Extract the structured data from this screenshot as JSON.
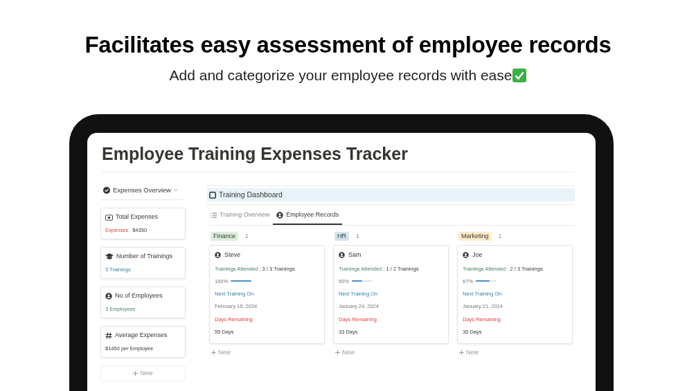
{
  "headline": "Facilitates easy assessment of employee records",
  "subheadline": "Add and categorize your employee records with ease",
  "page": {
    "title": "Employee Training Expenses Tracker"
  },
  "sidebar": {
    "heading": "Expenses Overview",
    "new_label": "New",
    "cards": [
      {
        "kind": "money",
        "title": "Total Expenses",
        "label": "Expenses : ",
        "value": "$4350"
      },
      {
        "kind": "cap",
        "title": "Number of Trainings",
        "label": "3 Trainings"
      },
      {
        "kind": "person",
        "title": "No of Employees",
        "label": "3 Employees"
      },
      {
        "kind": "hash",
        "title": "Average Expenses",
        "label": "$1450 per Employee"
      }
    ]
  },
  "dashboard": {
    "title": "Training Dashboard",
    "tabs": [
      {
        "kind": "list",
        "label": "Training Overview",
        "selected": false
      },
      {
        "kind": "person",
        "label": "Employee Records",
        "selected": true
      }
    ],
    "groups": [
      {
        "name": "Finance",
        "count": "1",
        "color": "#dbeddb",
        "new_label": "New",
        "card": {
          "name": "Steve",
          "attended_label": "Trainings Attended : ",
          "attended": "3 / 3 Trainings",
          "percent": "100%",
          "level": 1,
          "next_label": "Next Training On",
          "next_date": "February 15, 2024",
          "remaining_label": "Days Remaining",
          "remaining": "55 Days"
        }
      },
      {
        "name": "HR",
        "count": "1",
        "color": "#d3e5ef",
        "new_label": "New",
        "card": {
          "name": "Sam",
          "attended_label": "Trainings Attended : ",
          "attended": "1 / 2 Trainings",
          "percent": "50%",
          "level": 0.5,
          "next_label": "Next Training On",
          "next_date": "January 24, 2024",
          "remaining_label": "Days Remaining",
          "remaining": "33 Days"
        }
      },
      {
        "name": "Marketing",
        "count": "1",
        "color": "#fdecc8",
        "new_label": "New",
        "card": {
          "name": "Joe",
          "attended_label": "Trainings Attended : ",
          "attended": "2 / 3 Trainings",
          "percent": "67%",
          "level": 0.67,
          "next_label": "Next Training On",
          "next_date": "January 21, 2024",
          "remaining_label": "Days Remaining",
          "remaining": "30 Days"
        }
      }
    ]
  }
}
